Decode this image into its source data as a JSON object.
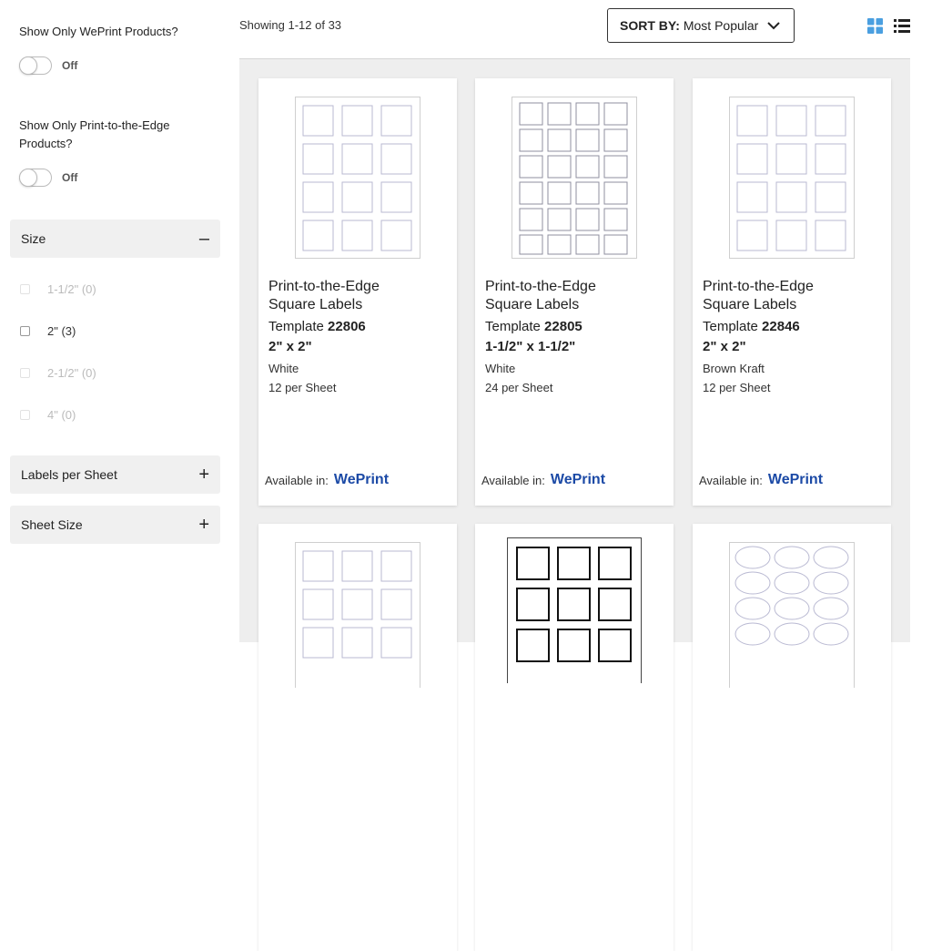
{
  "filters": {
    "weprint_only": {
      "label": "Show Only WePrint Products?",
      "state": "Off"
    },
    "print_edge_only": {
      "label": "Show Only Print-to-the-Edge Products?",
      "state": "Off"
    }
  },
  "size_filter": {
    "title": "Size",
    "sign": "–",
    "options": [
      {
        "label": "1-1/2\" (0)",
        "enabled": false
      },
      {
        "label": "2\" (3)",
        "enabled": true
      },
      {
        "label": "2-1/2\" (0)",
        "enabled": false
      },
      {
        "label": "4\" (0)",
        "enabled": false
      }
    ]
  },
  "labels_per_sheet": {
    "title": "Labels per Sheet",
    "sign": "+"
  },
  "sheet_size": {
    "title": "Sheet Size",
    "sign": "+"
  },
  "toolbar": {
    "showing": "Showing 1-12 of 33",
    "sort_prefix": "SORT BY:",
    "sort_value": "Most Popular",
    "grid_icon": "grid-view-icon",
    "list_icon": "list-view-icon",
    "accent": "#4a9fe0"
  },
  "products": [
    {
      "name_line1": "Print-to-the-Edge",
      "name_line2": "Square Labels",
      "template_prefix": "Template",
      "template_no": "22806",
      "dims": "2\" x 2\"",
      "color": "White",
      "per_sheet": "12 per Sheet",
      "available_label": "Available in:",
      "brand": "WePrint"
    },
    {
      "name_line1": "Print-to-the-Edge",
      "name_line2": "Square Labels",
      "template_prefix": "Template",
      "template_no": "22805",
      "dims": "1-1/2\" x 1-1/2\"",
      "color": "White",
      "per_sheet": "24 per Sheet",
      "available_label": "Available in:",
      "brand": "WePrint"
    },
    {
      "name_line1": "Print-to-the-Edge",
      "name_line2": "Square Labels",
      "template_prefix": "Template",
      "template_no": "22846",
      "dims": "2\" x 2\"",
      "color": "Brown Kraft",
      "per_sheet": "12 per Sheet",
      "available_label": "Available in:",
      "brand": "WePrint"
    }
  ],
  "brand_color": "#1c4aa6"
}
